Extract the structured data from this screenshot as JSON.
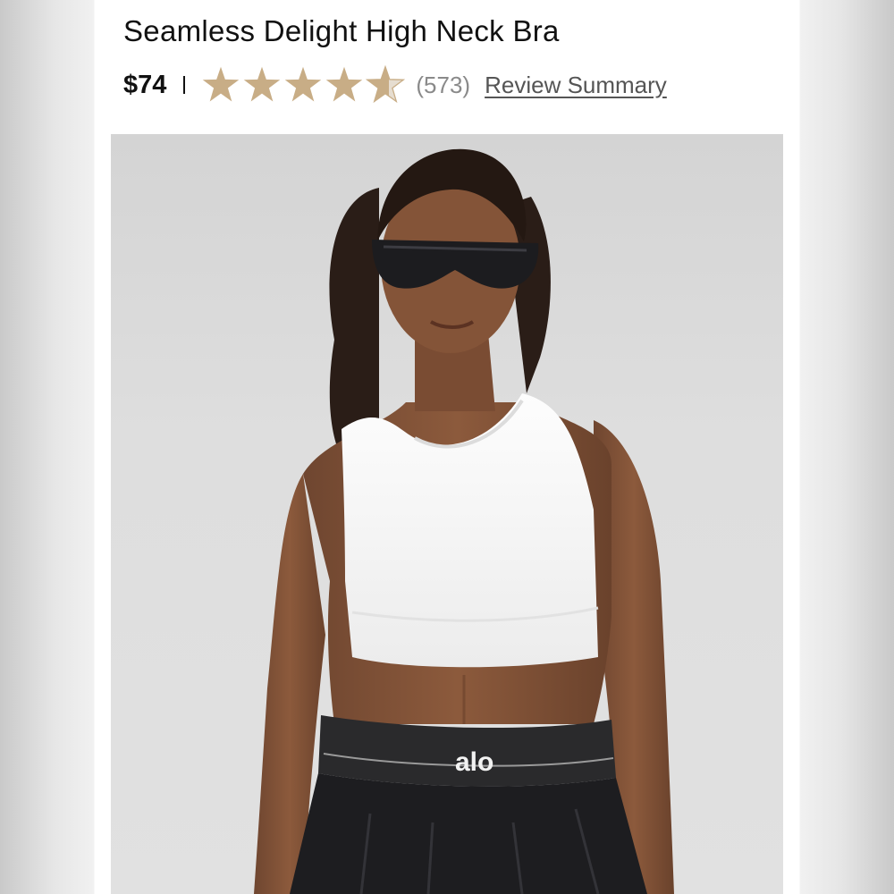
{
  "product": {
    "title": "Seamless Delight High Neck Bra",
    "price": "$74",
    "rating": 4.6,
    "rating_max": 5,
    "review_count": "(573)",
    "review_link_label": "Review Summary",
    "photo_logo_text": "alo"
  },
  "colors": {
    "star_filled": "#c8ad86",
    "star_empty": "#e6ddd0"
  },
  "icons": {
    "star": "star-icon"
  }
}
